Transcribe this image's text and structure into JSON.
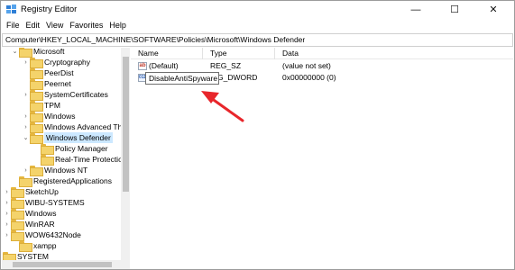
{
  "window": {
    "title": "Registry Editor",
    "minimize_glyph": "—",
    "maximize_glyph": "☐",
    "close_glyph": "✕"
  },
  "menu": [
    "File",
    "Edit",
    "View",
    "Favorites",
    "Help"
  ],
  "address": "Computer\\HKEY_LOCAL_MACHINE\\SOFTWARE\\Policies\\Microsoft\\Windows Defender",
  "tree": {
    "items": [
      {
        "label": "Microsoft",
        "expanded": true
      },
      {
        "label": "Cryptography"
      },
      {
        "label": "PeerDist"
      },
      {
        "label": "Peernet"
      },
      {
        "label": "SystemCertificates"
      },
      {
        "label": "TPM"
      },
      {
        "label": "Windows"
      },
      {
        "label": "Windows Advanced Th"
      },
      {
        "label": "Windows Defender",
        "expanded": true,
        "selected": true
      },
      {
        "label": "Policy Manager"
      },
      {
        "label": "Real-Time Protectio"
      },
      {
        "label": "Windows NT"
      },
      {
        "label": "RegisteredApplications"
      },
      {
        "label": "SketchUp"
      },
      {
        "label": "WIBU-SYSTEMS"
      },
      {
        "label": "Windows"
      },
      {
        "label": "WinRAR"
      },
      {
        "label": "WOW6432Node"
      },
      {
        "label": "xampp"
      },
      {
        "label": "SYSTEM"
      }
    ],
    "collapsed_glyph": "›",
    "expanded_glyph": "⌄"
  },
  "values": {
    "headers": {
      "name": "Name",
      "type": "Type",
      "data": "Data"
    },
    "rows": [
      {
        "icon": "string-value-icon",
        "icon_text": "ab",
        "name": "(Default)",
        "type": "REG_SZ",
        "data": "(value not set)"
      },
      {
        "icon": "binary-value-icon",
        "icon_text": "011",
        "name": "",
        "type": "G_DWORD",
        "data": "0x00000000 (0)"
      }
    ],
    "rename_value": "DisableAntiSpyware"
  },
  "colors": {
    "arrow": "#e8262b",
    "selection": "#cce8ff"
  }
}
